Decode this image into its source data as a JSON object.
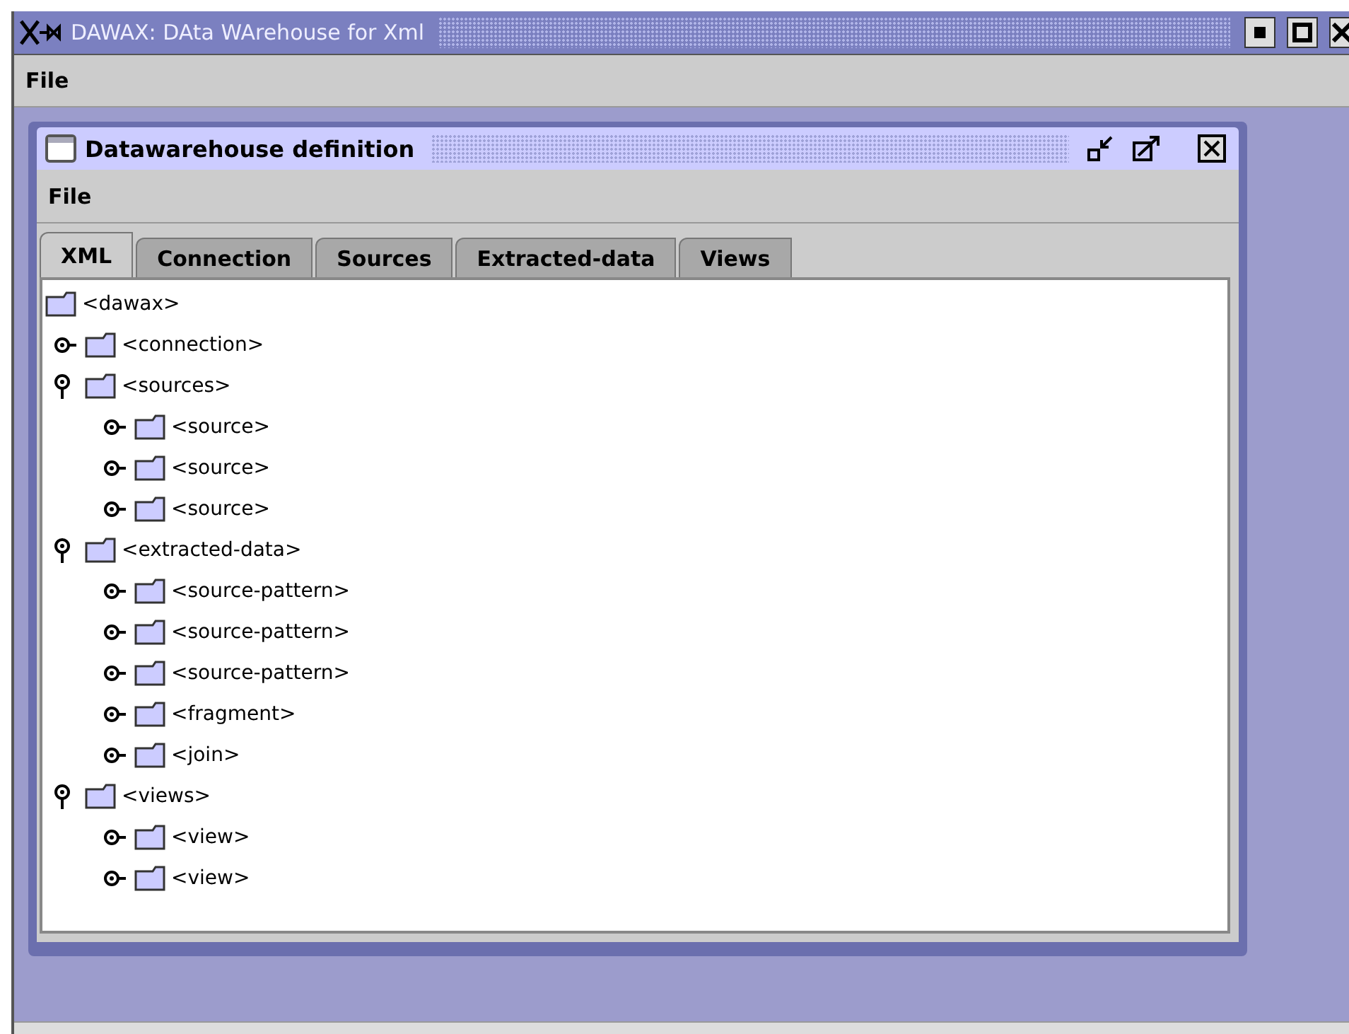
{
  "window": {
    "title": "DAWAX: DAta WArehouse for Xml"
  },
  "menu_bar": [
    "File"
  ],
  "inner_window": {
    "title": "Datawarehouse definition",
    "menu_bar": [
      "File"
    ],
    "tabs": [
      {
        "label": "XML",
        "selected": true
      },
      {
        "label": "Connection",
        "selected": false
      },
      {
        "label": "Sources",
        "selected": false
      },
      {
        "label": "Extracted-data",
        "selected": false
      },
      {
        "label": "Views",
        "selected": false
      }
    ],
    "tree": {
      "label": "<dawax>",
      "children": [
        {
          "label": "<connection>",
          "expanded": false
        },
        {
          "label": "<sources>",
          "expanded": true,
          "children": [
            {
              "label": "<source>",
              "expanded": false
            },
            {
              "label": "<source>",
              "expanded": false
            },
            {
              "label": "<source>",
              "expanded": false
            }
          ]
        },
        {
          "label": "<extracted-data>",
          "expanded": true,
          "children": [
            {
              "label": "<source-pattern>",
              "expanded": false
            },
            {
              "label": "<source-pattern>",
              "expanded": false
            },
            {
              "label": "<source-pattern>",
              "expanded": false
            },
            {
              "label": "<fragment>",
              "expanded": false
            },
            {
              "label": "<join>",
              "expanded": false
            }
          ]
        },
        {
          "label": "<views>",
          "expanded": true,
          "children": [
            {
              "label": "<view>",
              "expanded": false
            },
            {
              "label": "<view>",
              "expanded": false
            }
          ]
        }
      ]
    }
  }
}
